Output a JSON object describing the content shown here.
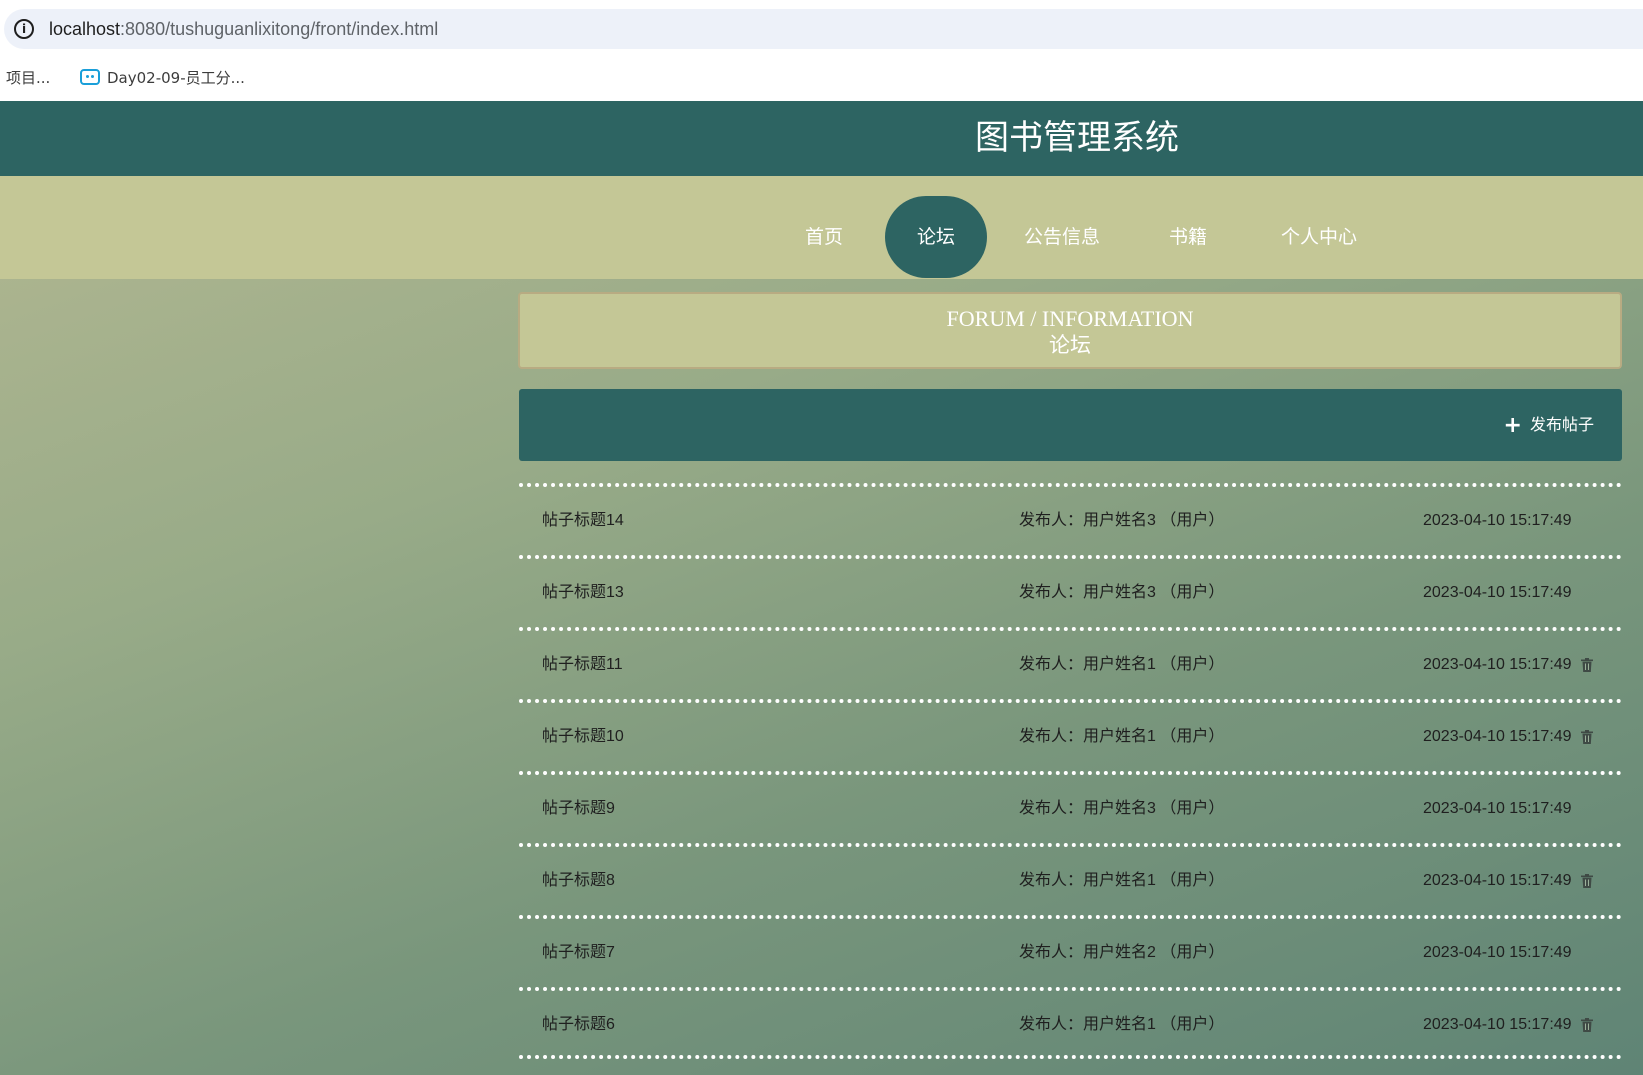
{
  "browser": {
    "url_host": "localhost",
    "url_rest": ":8080/tushuguanlixitong/front/index.html",
    "bookmarks": [
      "项目...",
      "Day02-09-员工分..."
    ]
  },
  "site": {
    "title": "图书管理系统"
  },
  "nav": {
    "items": [
      "首页",
      "论坛",
      "公告信息",
      "书籍",
      "个人中心"
    ],
    "active": "论坛"
  },
  "breadcrumb": {
    "en": "FORUM / INFORMATION",
    "cn": "论坛"
  },
  "actions": {
    "publish_label": "发布帖子"
  },
  "posts": [
    {
      "title": "帖子标题14",
      "author": "发布人：用户姓名3 （用户）",
      "time": "2023-04-10 15:17:49",
      "deletable": false
    },
    {
      "title": "帖子标题13",
      "author": "发布人：用户姓名3 （用户）",
      "time": "2023-04-10 15:17:49",
      "deletable": false
    },
    {
      "title": "帖子标题11",
      "author": "发布人：用户姓名1 （用户）",
      "time": "2023-04-10 15:17:49",
      "deletable": true
    },
    {
      "title": "帖子标题10",
      "author": "发布人：用户姓名1 （用户）",
      "time": "2023-04-10 15:17:49",
      "deletable": true
    },
    {
      "title": "帖子标题9",
      "author": "发布人：用户姓名3 （用户）",
      "time": "2023-04-10 15:17:49",
      "deletable": false
    },
    {
      "title": "帖子标题8",
      "author": "发布人：用户姓名1 （用户）",
      "time": "2023-04-10 15:17:49",
      "deletable": true
    },
    {
      "title": "帖子标题7",
      "author": "发布人：用户姓名2 （用户）",
      "time": "2023-04-10 15:17:49",
      "deletable": false
    },
    {
      "title": "帖子标题6",
      "author": "发布人：用户姓名1 （用户）",
      "time": "2023-04-10 15:17:49",
      "deletable": true
    }
  ],
  "colors": {
    "primary": "#2d6462",
    "nav_bg": "#c4c796"
  }
}
